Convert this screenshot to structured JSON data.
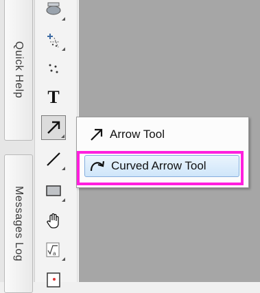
{
  "dock": {
    "tabs": [
      {
        "label": "Quick Help"
      },
      {
        "label": "Messages Log"
      }
    ]
  },
  "toolbar": {
    "tools": [
      {
        "icon": "mask-icon"
      },
      {
        "icon": "data-reader-icon"
      },
      {
        "icon": "scatter-points-icon"
      },
      {
        "icon": "text-tool-icon",
        "glyph": "T"
      },
      {
        "icon": "arrow-tool-icon"
      },
      {
        "icon": "line-tool-icon"
      },
      {
        "icon": "rectangle-tool-icon"
      },
      {
        "icon": "hand-tool-icon"
      },
      {
        "icon": "formula-tool-icon"
      },
      {
        "icon": "image-tool-icon"
      }
    ],
    "active_tool": "arrow-tool-icon"
  },
  "flyout": {
    "items": [
      {
        "label": "Arrow Tool",
        "icon": "arrow-icon"
      },
      {
        "label": "Curved Arrow Tool",
        "icon": "curved-arrow-icon",
        "selected": true
      }
    ],
    "highlight_color": "#ff1fde"
  }
}
